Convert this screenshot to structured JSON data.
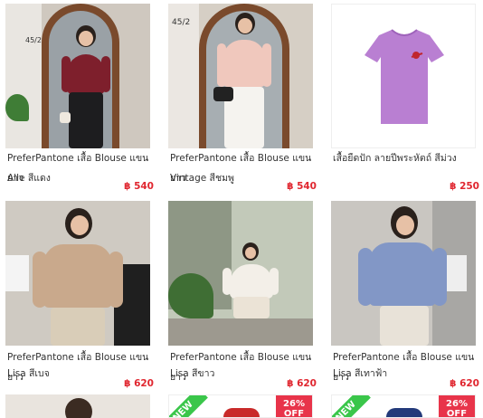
{
  "products": [
    {
      "name_line1": "PreferPantone เสื้อ Blouse แขนยาว",
      "name_line2": "Alle สีแดง",
      "price": "฿ 540",
      "house_number": "45/2"
    },
    {
      "name_line1": "PreferPantone เสื้อ Blouse แขนยาว",
      "name_line2": "Vintage สีชมพู",
      "price": "฿ 540",
      "house_number": "45/2"
    },
    {
      "name_line1": "เสื้อยืดปัก ลายปีพระหัตถ์ สีม่วง",
      "name_line2": "",
      "price": "฿ 250"
    },
    {
      "name_line1": "PreferPantone เสื้อ Blouse แขนยาว",
      "name_line2": "Lisa สีเบจ",
      "price": "฿ 620"
    },
    {
      "name_line1": "PreferPantone เสื้อ Blouse แขนยาว",
      "name_line2": "Lisa สีขาว",
      "price": "฿ 620"
    },
    {
      "name_line1": "PreferPantone เสื้อ Blouse แขนยาว",
      "name_line2": "Lisa สีเทาฟ้า",
      "price": "฿ 620"
    }
  ],
  "partial_row": [
    {
      "badges": []
    },
    {
      "badge_new": "NEW",
      "badge_off_pct": "26%",
      "badge_off_word": "OFF"
    },
    {
      "badge_new": "NEW",
      "badge_off_pct": "26%",
      "badge_off_word": "OFF"
    }
  ],
  "colors": {
    "price": "#e0262f",
    "badge_new": "#3ac64a",
    "badge_off": "#e8344a"
  }
}
